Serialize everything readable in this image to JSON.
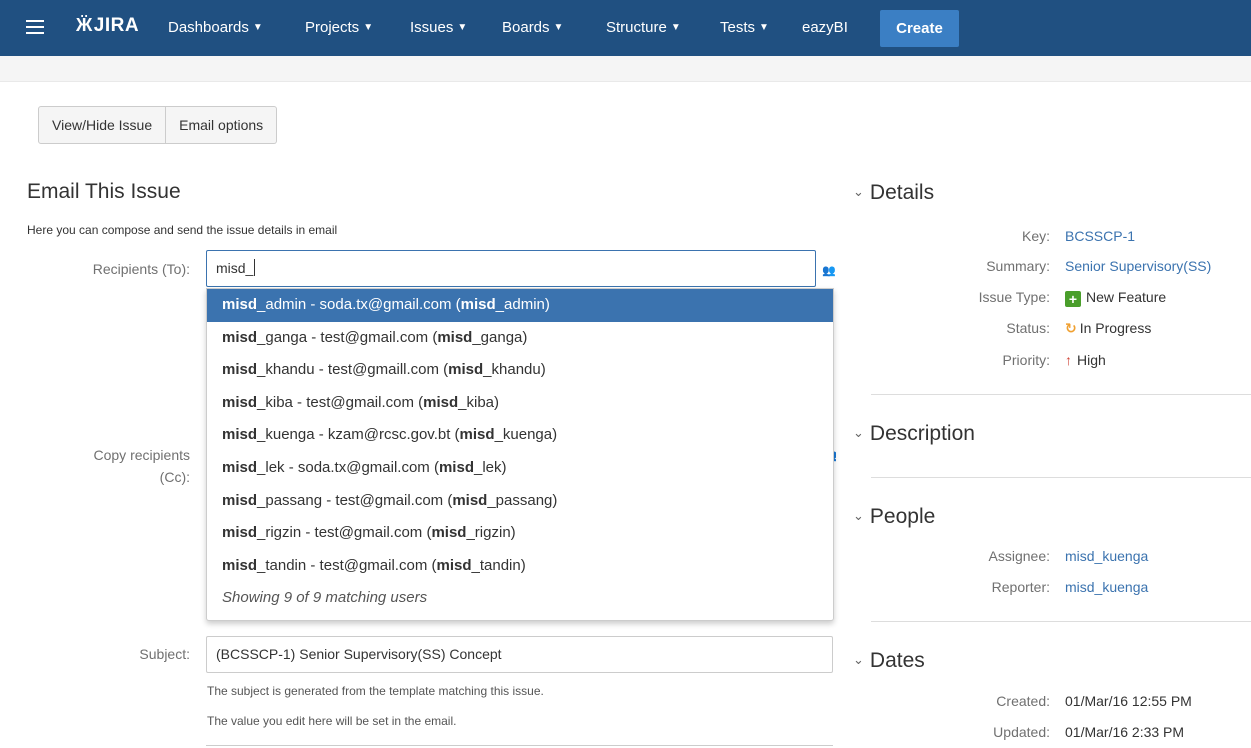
{
  "nav": {
    "logo": "JIRA",
    "items": [
      {
        "label": "Dashboards",
        "caret": true
      },
      {
        "label": "Projects",
        "caret": true
      },
      {
        "label": "Issues",
        "caret": true
      },
      {
        "label": "Boards",
        "caret": true
      },
      {
        "label": "Structure",
        "caret": true
      },
      {
        "label": "Tests",
        "caret": true
      },
      {
        "label": "eazyBI",
        "caret": false
      }
    ],
    "create_label": "Create"
  },
  "toolbar": {
    "view_hide_label": "View/Hide Issue",
    "email_options_label": "Email options"
  },
  "page": {
    "title": "Email This Issue",
    "description": "Here you can compose and send the issue details in email"
  },
  "form": {
    "recipients_to_label": "Recipients (To):",
    "recipients_to_value": "misd_",
    "copy_recipients_label_1": "Copy recipients",
    "copy_recipients_label_2": "(Cc):",
    "subject_label": "Subject:",
    "subject_value": "(BCSSCP-1) Senior Supervisory(SS) Concept",
    "subject_help_1": "The subject is generated from the template matching this issue.",
    "subject_help_2": "The value you edit here will be set in the email."
  },
  "suggestions": {
    "query": "misd",
    "items": [
      {
        "rest": "_admin - soda.tx@gmail.com (",
        "rest2": "_admin)"
      },
      {
        "rest": "_ganga - test@gmail.com (",
        "rest2": "_ganga)"
      },
      {
        "rest": "_khandu - test@gmaill.com (",
        "rest2": "_khandu)"
      },
      {
        "rest": "_kiba - test@gmail.com (",
        "rest2": "_kiba)"
      },
      {
        "rest": "_kuenga - kzam@rcsc.gov.bt (",
        "rest2": "_kuenga)"
      },
      {
        "rest": "_lek - soda.tx@gmail.com (",
        "rest2": "_lek)"
      },
      {
        "rest": "_passang - test@gmail.com (",
        "rest2": "_passang)"
      },
      {
        "rest": "_rigzin - test@gmail.com (",
        "rest2": "_rigzin)"
      },
      {
        "rest": "_tandin - test@gmail.com (",
        "rest2": "_tandin)"
      }
    ],
    "footer": "Showing 9 of 9 matching users"
  },
  "details": {
    "heading": "Details",
    "key_label": "Key:",
    "key_value": "BCSSCP-1",
    "summary_label": "Summary:",
    "summary_value": "Senior Supervisory(SS)",
    "type_label": "Issue Type:",
    "type_value": "New Feature",
    "status_label": "Status:",
    "status_value": "In Progress",
    "priority_label": "Priority:",
    "priority_value": "High"
  },
  "description_section": {
    "heading": "Description"
  },
  "people": {
    "heading": "People",
    "assignee_label": "Assignee:",
    "assignee_value": "misd_kuenga",
    "reporter_label": "Reporter:",
    "reporter_value": "misd_kuenga"
  },
  "dates": {
    "heading": "Dates",
    "created_label": "Created:",
    "created_value": "01/Mar/16 12:55 PM",
    "updated_label": "Updated:",
    "updated_value": "01/Mar/16 2:33 PM"
  },
  "colors": {
    "nav_bg": "#205081",
    "link": "#3b73af",
    "highlight": "#3b73af",
    "create_btn": "#3b7fc4"
  }
}
